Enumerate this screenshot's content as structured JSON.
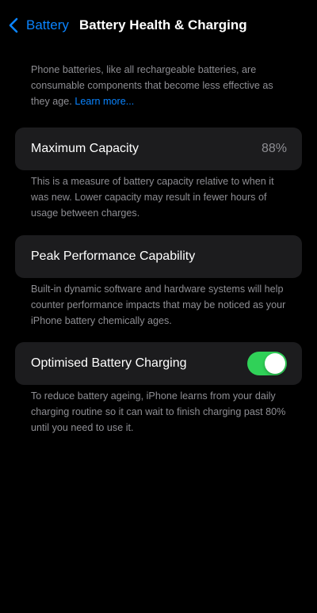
{
  "nav": {
    "back_label": "Battery",
    "title": "Battery Health & Charging"
  },
  "intro": {
    "text": "Phone batteries, like all rechargeable batteries, are consumable components that become less effective as they age. ",
    "link_label": "Learn more..."
  },
  "maximum_capacity": {
    "label": "Maximum Capacity",
    "value": "88%",
    "note": "This is a measure of battery capacity relative to when it was new. Lower capacity may result in fewer hours of usage between charges."
  },
  "peak_performance": {
    "label": "Peak Performance Capability",
    "note": "Built-in dynamic software and hardware systems will help counter performance impacts that may be noticed as your iPhone battery chemically ages."
  },
  "optimised_charging": {
    "label": "Optimised Battery Charging",
    "enabled": true,
    "note": "To reduce battery ageing, iPhone learns from your daily charging routine so it can wait to finish charging past 80% until you need to use it."
  },
  "colors": {
    "background": "#000000",
    "cell_background": "#1c1c1e",
    "accent_blue": "#0a84ff",
    "toggle_on_green": "#30d158",
    "secondary_text": "#8e8e93"
  }
}
